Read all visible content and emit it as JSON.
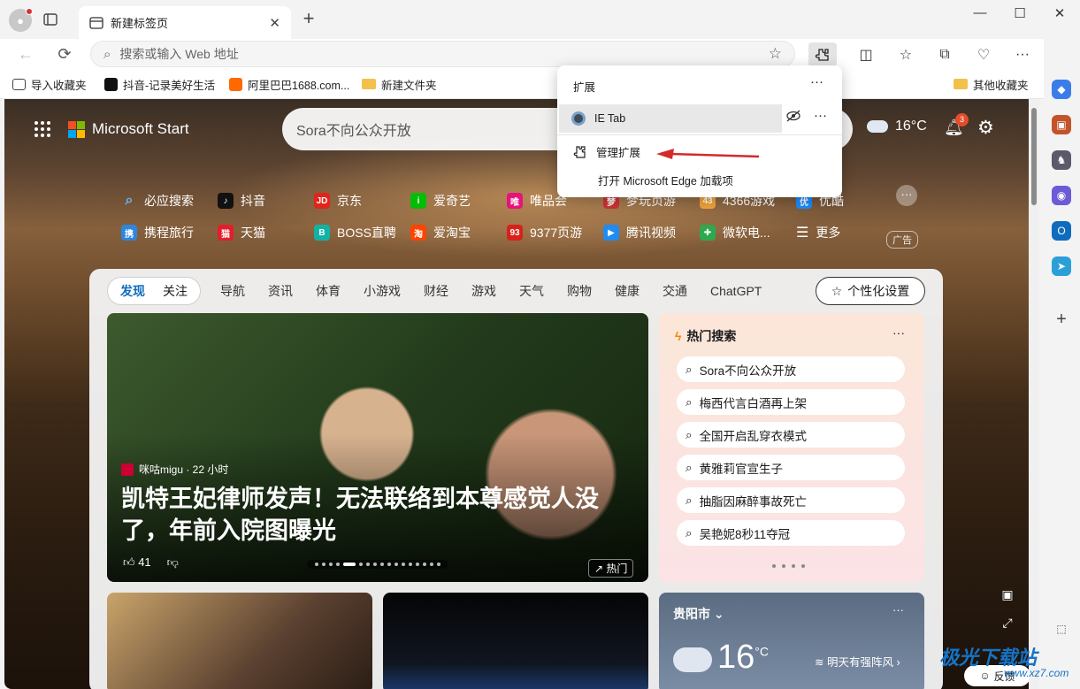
{
  "browser": {
    "tab_title": "新建标签页",
    "address_placeholder": "搜索或输入 Web 地址",
    "favorites": [
      {
        "label": "导入收藏夹"
      },
      {
        "label": "抖音-记录美好生活"
      },
      {
        "label": "阿里巴巴1688.com..."
      },
      {
        "label": "新建文件夹"
      },
      {
        "label": "其他收藏夹"
      }
    ]
  },
  "extensions_popup": {
    "title": "扩展",
    "items": [
      {
        "label": "IE Tab"
      }
    ],
    "manage_label": "管理扩展",
    "open_addons_label": "打开 Microsoft Edge 加载项"
  },
  "newtab": {
    "brand": "Microsoft Start",
    "search_placeholder": "Sora不向公众开放",
    "weather_temp": "16°C",
    "notif_count": "3",
    "quick_links_row1": [
      "必应搜索",
      "抖音",
      "京东",
      "爱奇艺",
      "唯品会",
      "梦玩页游",
      "4366游戏",
      "优酷"
    ],
    "quick_links_row2": [
      "携程旅行",
      "天猫",
      "BOSS直聘",
      "爱淘宝",
      "9377页游",
      "腾讯视频",
      "微软电...",
      "更多"
    ],
    "ad_label": "广告",
    "feed_tabs": [
      "发现",
      "关注"
    ],
    "feed_nav": [
      "导航",
      "资讯",
      "体育",
      "小游戏",
      "财经",
      "游戏",
      "天气",
      "购物",
      "健康",
      "交通",
      "ChatGPT"
    ],
    "personalize": "个性化设置",
    "hero": {
      "source": "咪咕migu · 22 小时",
      "title": "凯特王妃律师发声！无法联络到本尊感觉人没了，年前入院图曝光",
      "likes": "41",
      "hot": "热门"
    },
    "hot_search": {
      "title": "热门搜索",
      "items": [
        "Sora不向公众开放",
        "梅西代言白酒再上架",
        "全国开启乱穿衣模式",
        "黄雅莉官宣生子",
        "抽脂因麻醉事故死亡",
        "吴艳妮8秒11夺冠"
      ]
    },
    "weather_card": {
      "city": "贵阳市",
      "temp": "16",
      "unit": "°C",
      "tomorrow": "明天有强阵风"
    },
    "feedback": "反馈"
  },
  "watermark": {
    "main": "极光下载站",
    "sub": "www.xz7.com"
  }
}
